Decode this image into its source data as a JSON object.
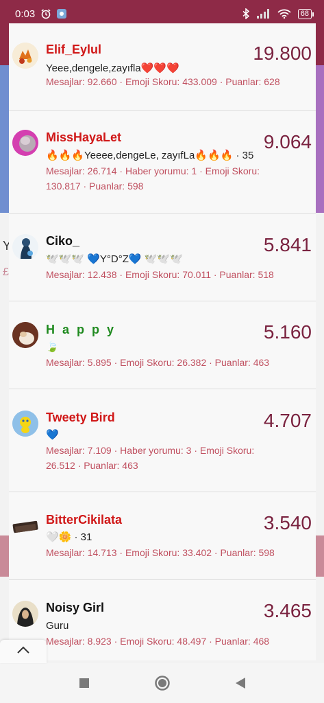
{
  "status_bar": {
    "time": "0:03",
    "battery": "68"
  },
  "background": {
    "ghost_1": "Y",
    "ghost_2": "£"
  },
  "leaderboard": [
    {
      "username": "Elif_Eylul",
      "name_color": "red",
      "bio": "Yeee,dengele,zayıfla❤️❤️❤️",
      "stats": "Mesajlar: 92.660 · Emoji Skoru: 433.009 · Puanlar: 628",
      "score": "19.800",
      "avatar": "autumn-leaves-avatar"
    },
    {
      "username": "MissHayaLet",
      "name_color": "red",
      "bio": "🔥🔥🔥Yeeee,dengeLe, zayıfLa🔥🔥🔥 · 35",
      "stats": "Mesajlar: 26.714 · Haber yorumu: 1 · Emoji Skoru: 130.817 · Puanlar: 598",
      "score": "9.064",
      "avatar": "pink-portrait-avatar"
    },
    {
      "username": "Ciko_",
      "name_color": "black",
      "bio": "🕊️🕊️🕊️ 💙Y°D°Z💙 🕊️🕊️🕊️",
      "stats": "Mesajlar: 12.438 · Emoji Skoru: 70.011 · Puanlar: 518",
      "score": "5.841",
      "avatar": "hooded-figure-avatar"
    },
    {
      "username": "H a p p y",
      "name_color": "green",
      "bio": "🍃",
      "stats": "Mesajlar: 5.895 · Emoji Skoru: 26.382 · Puanlar: 463",
      "score": "5.160",
      "avatar": "hands-avatar"
    },
    {
      "username": "Tweety Bird",
      "name_color": "red",
      "bio": "💙",
      "stats": "Mesajlar: 7.109 · Haber yorumu: 3 · Emoji Skoru: 26.512 · Puanlar: 463",
      "score": "4.707",
      "avatar": "tweety-avatar"
    },
    {
      "username": "BitterCikilata",
      "name_color": "red",
      "bio": "🤍🌼 · 31",
      "stats": "Mesajlar: 14.713 · Emoji Skoru: 33.402 · Puanlar: 598",
      "score": "3.540",
      "avatar": "chocolate-avatar"
    },
    {
      "username": "Noisy Girl",
      "name_color": "black",
      "bio": "Guru",
      "stats": "Mesajlar: 8.923 · Emoji Skoru: 48.497 · Puanlar: 468",
      "score": "3.465",
      "avatar": "hijab-girl-avatar"
    }
  ],
  "icons": {
    "alarm": "alarm-clock-icon",
    "app_notification": "app-notification-icon",
    "bluetooth": "bluetooth-icon",
    "signal": "signal-icon",
    "wifi": "wifi-icon",
    "collapse": "chevron-up-icon",
    "nav": [
      "square-recents-icon",
      "circle-home-icon",
      "triangle-back-icon"
    ]
  },
  "colors": {
    "accent": "#8e2a47",
    "score": "#7a2340",
    "stats": "#c05060",
    "red_name": "#d01818",
    "green_name": "#1f8a1f"
  }
}
